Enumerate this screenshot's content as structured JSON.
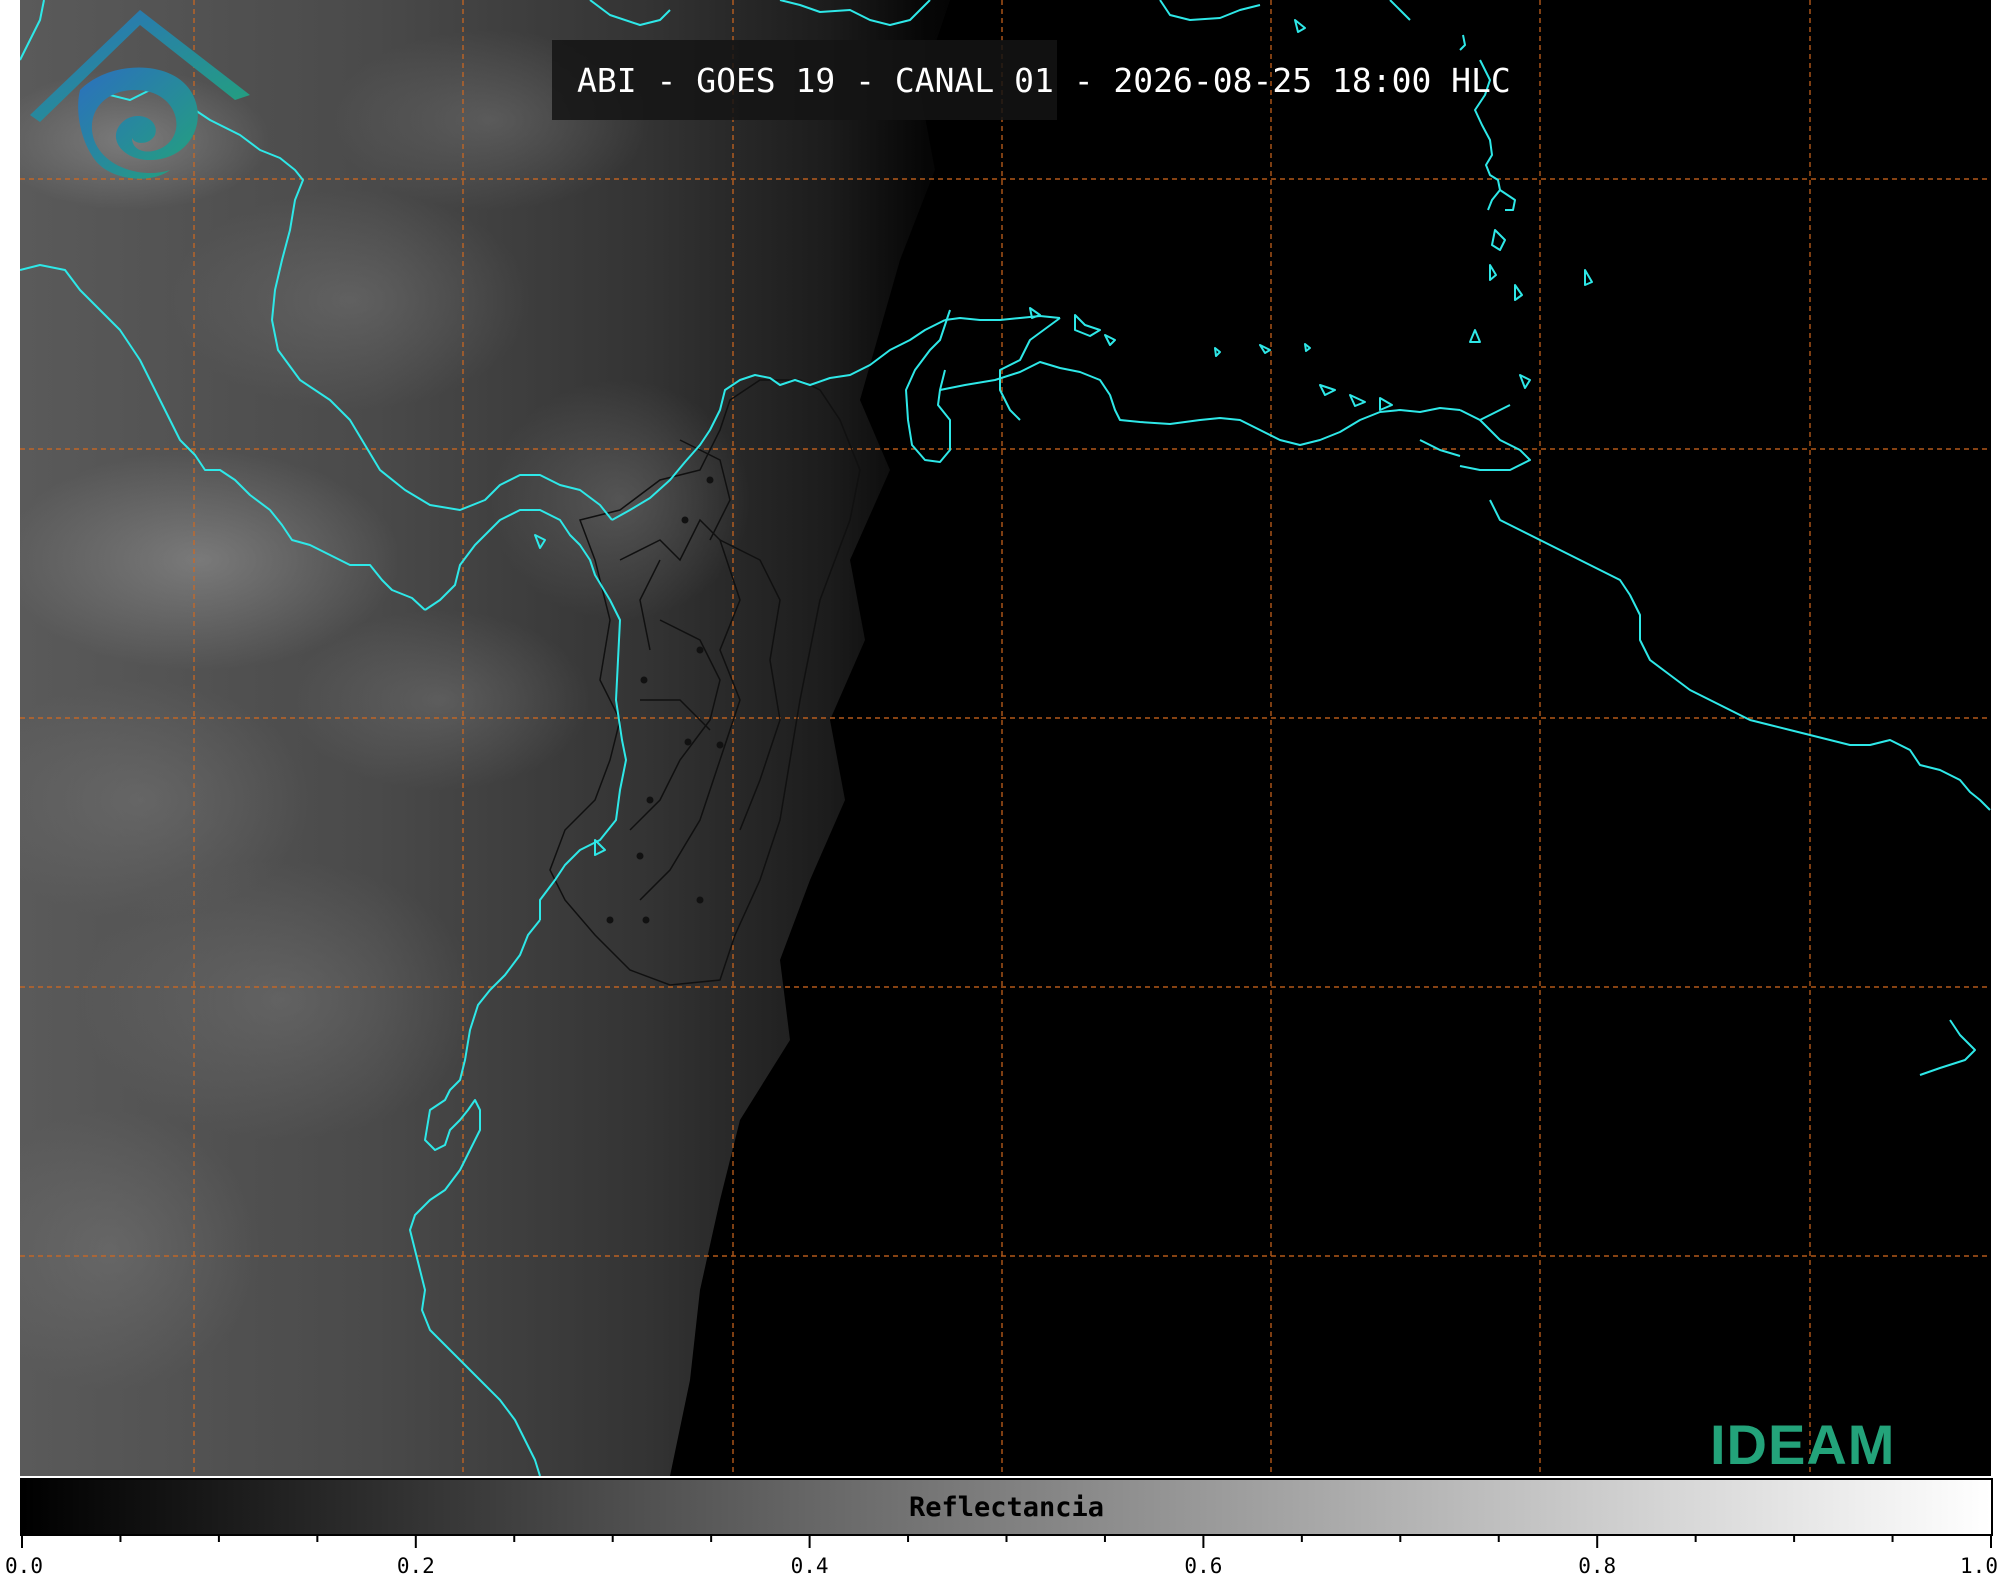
{
  "image": {
    "title": "ABI - GOES 19 - CANAL 01 - 2026-08-25 18:00 HLC",
    "description_layers": [
      "satellite-visible-reflectance",
      "coastlines",
      "country-borders",
      "lat-lon-grid"
    ]
  },
  "colors": {
    "coastline": "#2ee8e8",
    "grid": "#d2691e",
    "borders": "#101010",
    "logo_blue": "#2b6fbf",
    "logo_green": "#23a37a"
  },
  "colorbar": {
    "label": "Reflectancia",
    "min": 0.0,
    "max": 1.0,
    "tick_labels": [
      "0.0",
      "0.2",
      "0.4",
      "0.6",
      "0.8",
      "1.0"
    ],
    "gradient": [
      "#000000",
      "#ffffff"
    ]
  },
  "logo": {
    "text": "IDEAM"
  }
}
